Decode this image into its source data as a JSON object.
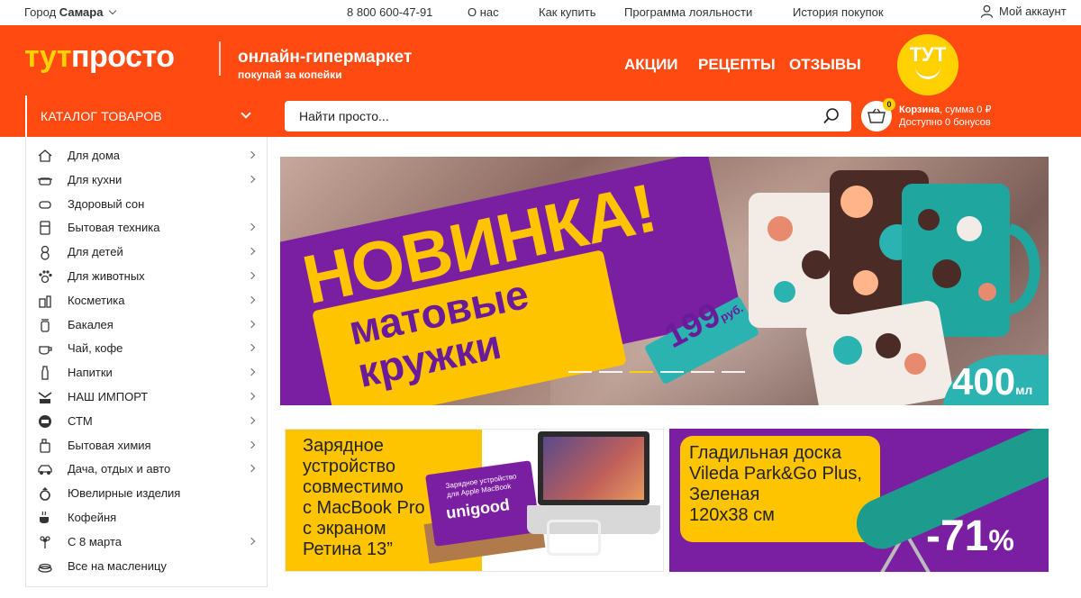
{
  "topbar": {
    "city_prefix": "Город",
    "city_name": "Самара",
    "phone": "8 800 600-47-91",
    "links": [
      "О нас",
      "Как купить",
      "Программа лояльности",
      "История покупок"
    ],
    "account": "Мой аккаунт"
  },
  "header": {
    "logo_part1": "тут",
    "logo_part2": "просто",
    "tagline": "онлайн-гипермаркет",
    "subtagline": "покупай за копейки",
    "nav": [
      "АКЦИИ",
      "РЕЦЕПТЫ",
      "ОТЗЫВЫ"
    ],
    "badge_text": "ТУТ",
    "catalog_button": "КАТАЛОГ ТОВАРОВ",
    "search_placeholder": "Найти просто...",
    "cart": {
      "count": "0",
      "label": "Корзина",
      "sum_text": ", сумма 0 ₽",
      "bonus_text": "Доступно 0 бонусов"
    }
  },
  "sidebar": {
    "items": [
      {
        "label": "Для дома",
        "icon": "house-icon",
        "arrow": true
      },
      {
        "label": "Для кухни",
        "icon": "pot-icon",
        "arrow": true
      },
      {
        "label": "Здоровый сон",
        "icon": "pillow-icon",
        "arrow": false
      },
      {
        "label": "Бытовая техника",
        "icon": "appliance-icon",
        "arrow": true
      },
      {
        "label": "Для детей",
        "icon": "teddy-bear-icon",
        "arrow": true
      },
      {
        "label": "Для животных",
        "icon": "paw-icon",
        "arrow": true
      },
      {
        "label": "Косметика",
        "icon": "cosmetics-icon",
        "arrow": true
      },
      {
        "label": "Бакалея",
        "icon": "jar-icon",
        "arrow": true
      },
      {
        "label": "Чай, кофе",
        "icon": "tea-icon",
        "arrow": true
      },
      {
        "label": "Напитки",
        "icon": "bottle-icon",
        "arrow": true
      },
      {
        "label": "НАШ ИМПОРТ",
        "icon": "import-icon",
        "arrow": true
      },
      {
        "label": "СТМ",
        "icon": "stm-icon",
        "arrow": true
      },
      {
        "label": "Бытовая химия",
        "icon": "chemicals-icon",
        "arrow": true
      },
      {
        "label": "Дача, отдых и авто",
        "icon": "car-icon",
        "arrow": true
      },
      {
        "label": "Ювелирные изделия",
        "icon": "ring-icon",
        "arrow": false
      },
      {
        "label": "Кофейня",
        "icon": "coffee-cup-icon",
        "arrow": false
      },
      {
        "label": "С 8 марта",
        "icon": "flower-icon",
        "arrow": true
      },
      {
        "label": "Все на масленицу",
        "icon": "pancakes-icon",
        "arrow": false
      }
    ]
  },
  "hero": {
    "headline": "НОВИНКА!",
    "line2": "матовые",
    "line3": "кружки",
    "price": "199",
    "price_unit": "руб.",
    "volume": "400",
    "volume_unit": "мл",
    "active_slide": 3,
    "slide_count": 6
  },
  "promo_left": {
    "text": [
      "Зарядное",
      "устройство",
      "совместимо",
      "с MacBook Pro",
      "с экраном",
      "Ретина 13”"
    ],
    "box_small": "Зарядное устройство для Apple MacBook",
    "box_brand": "unigood"
  },
  "promo_right": {
    "text": [
      "Гладильная доска",
      "Vileda Park&Go Plus,",
      "Зеленая",
      "120х38 см"
    ],
    "discount": "-71",
    "discount_unit": "%"
  },
  "colors": {
    "brand_orange": "#ff4a12",
    "brand_yellow": "#ffd100",
    "purple": "#7b1fa2",
    "teal": "#2ab3b0"
  }
}
